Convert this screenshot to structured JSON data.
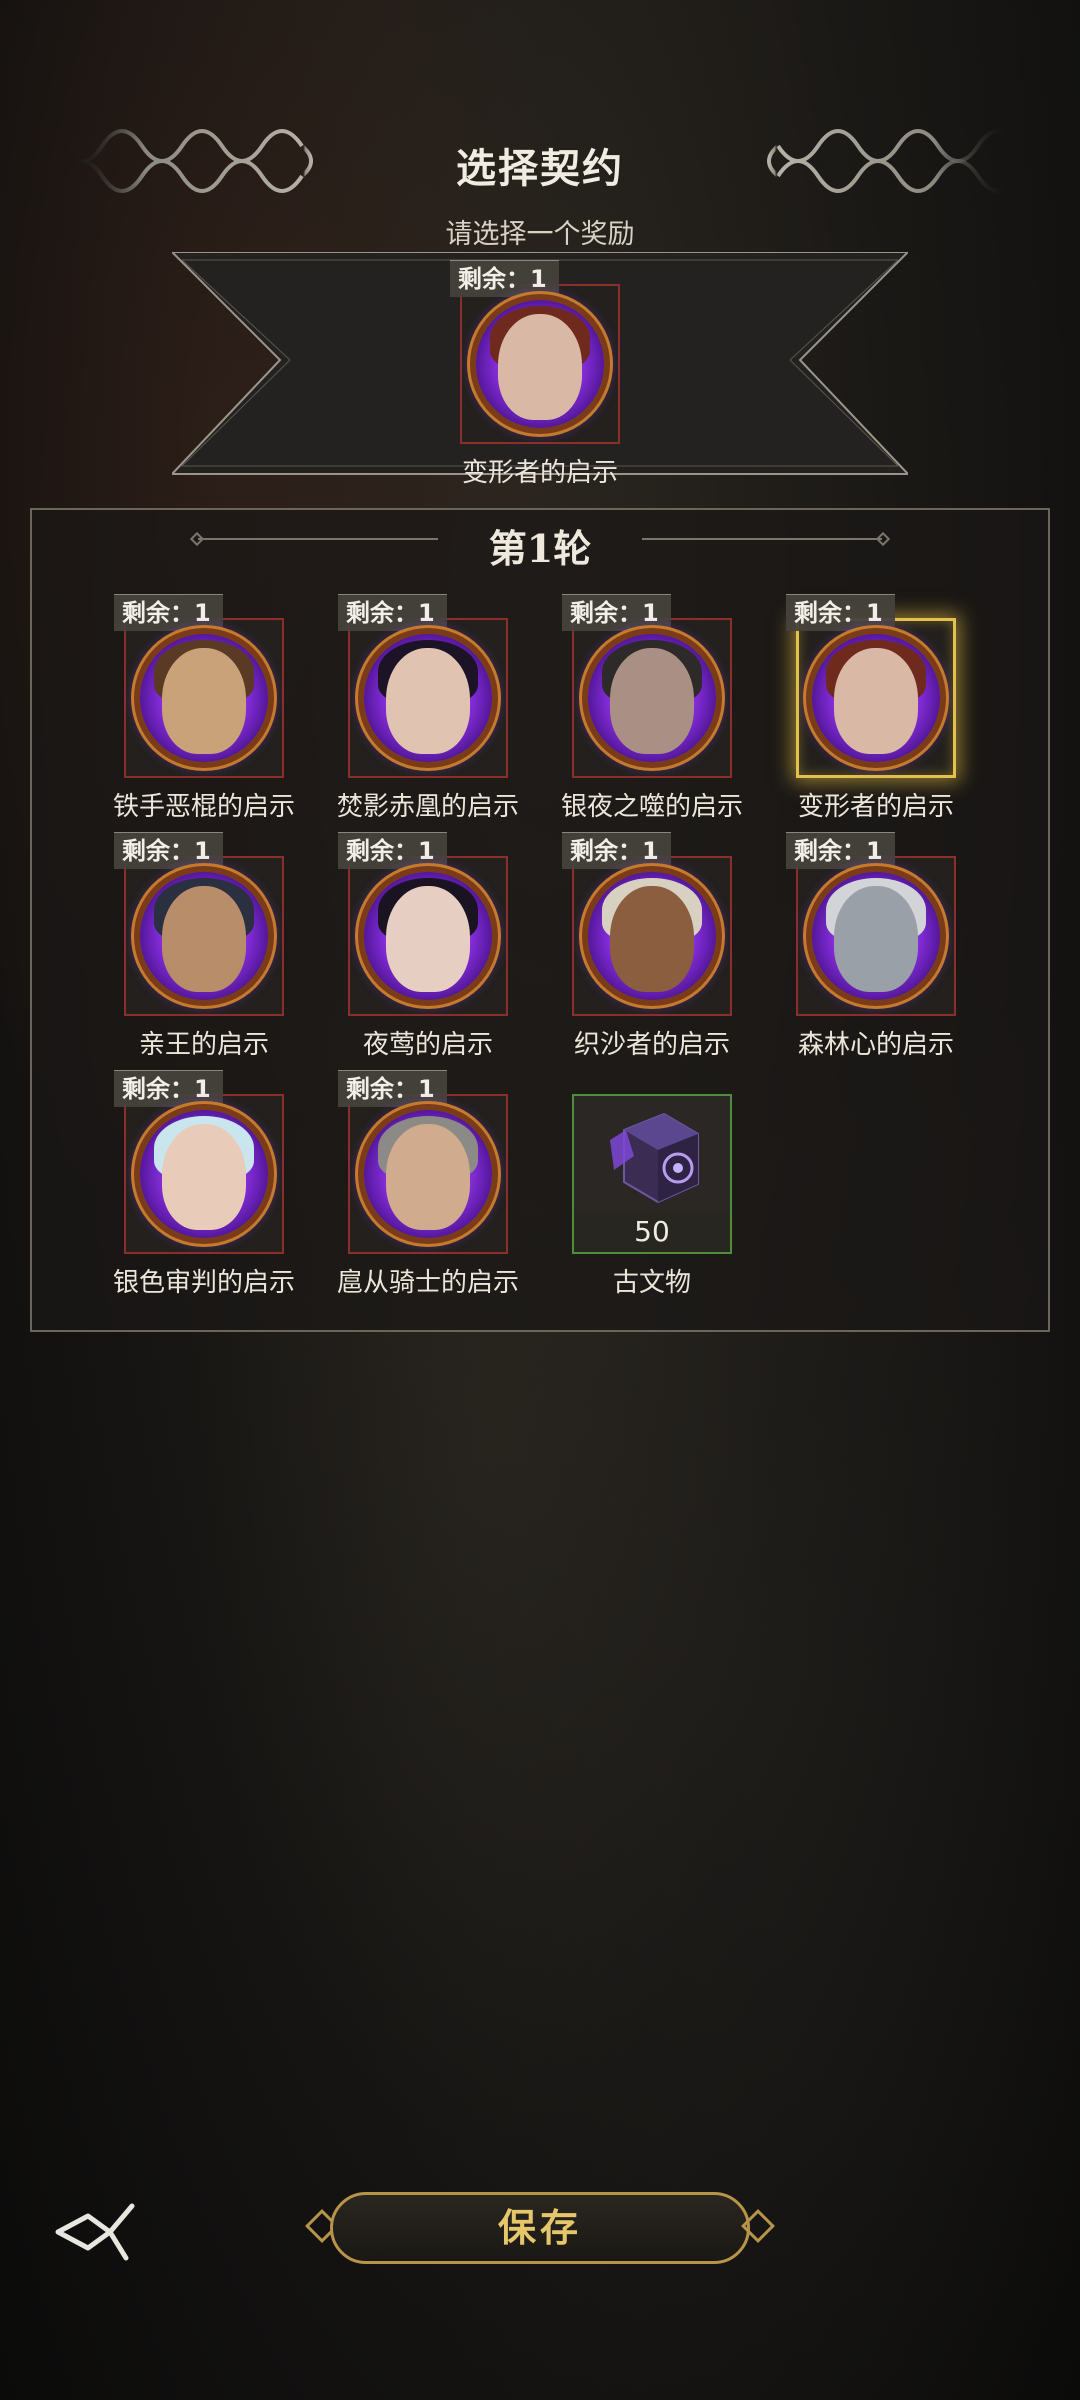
{
  "header": {
    "title": "选择契约",
    "subtitle": "请选择一个奖励"
  },
  "reward": {
    "remain_label": "剩余：",
    "remain_value": "1",
    "name": "变形者的启示",
    "icon": "shapeshifter-portrait"
  },
  "round": {
    "title": "第1轮",
    "items": [
      {
        "remain_label": "剩余：",
        "remain_value": "1",
        "name": "铁手恶棍的启示",
        "icon": "bearded-dwarf-portrait"
      },
      {
        "remain_label": "剩余：",
        "remain_value": "1",
        "name": "焚影赤凰的启示",
        "icon": "dark-haired-woman-portrait"
      },
      {
        "remain_label": "剩余：",
        "remain_value": "1",
        "name": "银夜之噬的启示",
        "icon": "masked-man-portrait"
      },
      {
        "remain_label": "剩余：",
        "remain_value": "1",
        "name": "变形者的启示",
        "icon": "shapeshifter-portrait",
        "selected": true
      },
      {
        "remain_label": "剩余：",
        "remain_value": "1",
        "name": "亲王的启示",
        "icon": "prince-portrait"
      },
      {
        "remain_label": "剩余：",
        "remain_value": "1",
        "name": "夜莺的启示",
        "icon": "nightingale-portrait"
      },
      {
        "remain_label": "剩余：",
        "remain_value": "1",
        "name": "织沙者的启示",
        "icon": "sandweaver-portrait"
      },
      {
        "remain_label": "剩余：",
        "remain_value": "1",
        "name": "森林心的启示",
        "icon": "forest-heart-portrait"
      },
      {
        "remain_label": "剩余：",
        "remain_value": "1",
        "name": "银色审判的启示",
        "icon": "silver-judge-portrait"
      },
      {
        "remain_label": "剩余：",
        "remain_value": "1",
        "name": "扈从骑士的启示",
        "icon": "squire-knight-portrait"
      }
    ],
    "relic": {
      "name": "古文物",
      "count": "50",
      "icon": "relic-cube-icon"
    }
  },
  "footer": {
    "save_label": "保存",
    "back_icon": "back-arrow-icon"
  },
  "colors": {
    "frame_red": "#8c2f2a",
    "frame_green": "#4f8d3a",
    "selected_gold": "#e3c14a",
    "orb_purple": "#8a2fe0",
    "save_gold": "#e6c66b"
  }
}
